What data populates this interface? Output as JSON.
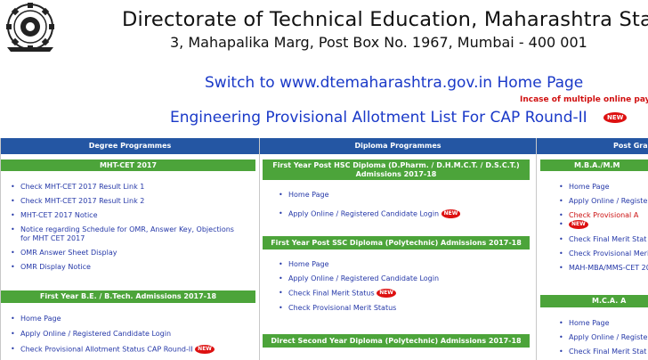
{
  "header": {
    "title": "Directorate of Technical Education, Maharashtra Sta",
    "address": "3, Mahapalika Marg, Post Box No. 1967, Mumbai - 400 001"
  },
  "switch_link": "Switch to www.dtemaharashtra.gov.in Home Page",
  "incase_note": "Incase of multiple online payme",
  "eng_link": "Engineering Provisional Allotment List For CAP Round-II",
  "new_badge": "NEW",
  "degree": {
    "heading": "Degree Programmes",
    "mhtcet": {
      "title": "MHT-CET 2017",
      "items": [
        "Check MHT-CET 2017 Result Link 1",
        "Check MHT-CET 2017 Result Link 2",
        "MHT-CET 2017 Notice",
        "Notice regarding Schedule for OMR, Answer Key, Objections for MHT CET 2017",
        "OMR Answer Sheet Display",
        "OMR Display Notice"
      ]
    },
    "be": {
      "title": "First Year B.E. / B.Tech. Admissions 2017-18",
      "items": [
        "Home Page",
        "Apply Online / Registered Candidate Login",
        "Check Provisional Allotment Status CAP Round-II"
      ]
    }
  },
  "diploma": {
    "heading": "Diploma Programmes",
    "hsc": {
      "title": "First Year Post HSC Diploma (D.Pharm. / D.H.M.C.T. / D.S.C.T.) Admissions 2017-18",
      "items": [
        "Home Page",
        "Apply Online / Registered Candidate Login"
      ]
    },
    "ssc": {
      "title": "First Year Post SSC Diploma (Polytechnic) Admissions 2017-18",
      "items": [
        "Home Page",
        "Apply Online / Registered Candidate Login",
        "Check Final Merit Status",
        "Check Provisional Merit Status"
      ]
    },
    "dsd": {
      "title": "Direct Second Year Diploma (Polytechnic) Admissions 2017-18"
    }
  },
  "postgrad": {
    "heading": "Post Gra",
    "mba": {
      "title": "M.B.A./M.M",
      "items": [
        "Home Page",
        "Apply Online / Registe",
        "Check Provisional A",
        "Check Final Merit Stat",
        "Check Provisional Meri",
        "MAH-MBA/MMS-CET 20"
      ]
    },
    "mca": {
      "title": "M.C.A. A",
      "items": [
        "Home Page",
        "Apply Online / Registe",
        "Check Final Merit Stat"
      ]
    }
  },
  "colors": {
    "blue_header": "#2456a3",
    "green_header": "#4ca43a",
    "link": "#1a39c8",
    "red": "#cc1111"
  }
}
